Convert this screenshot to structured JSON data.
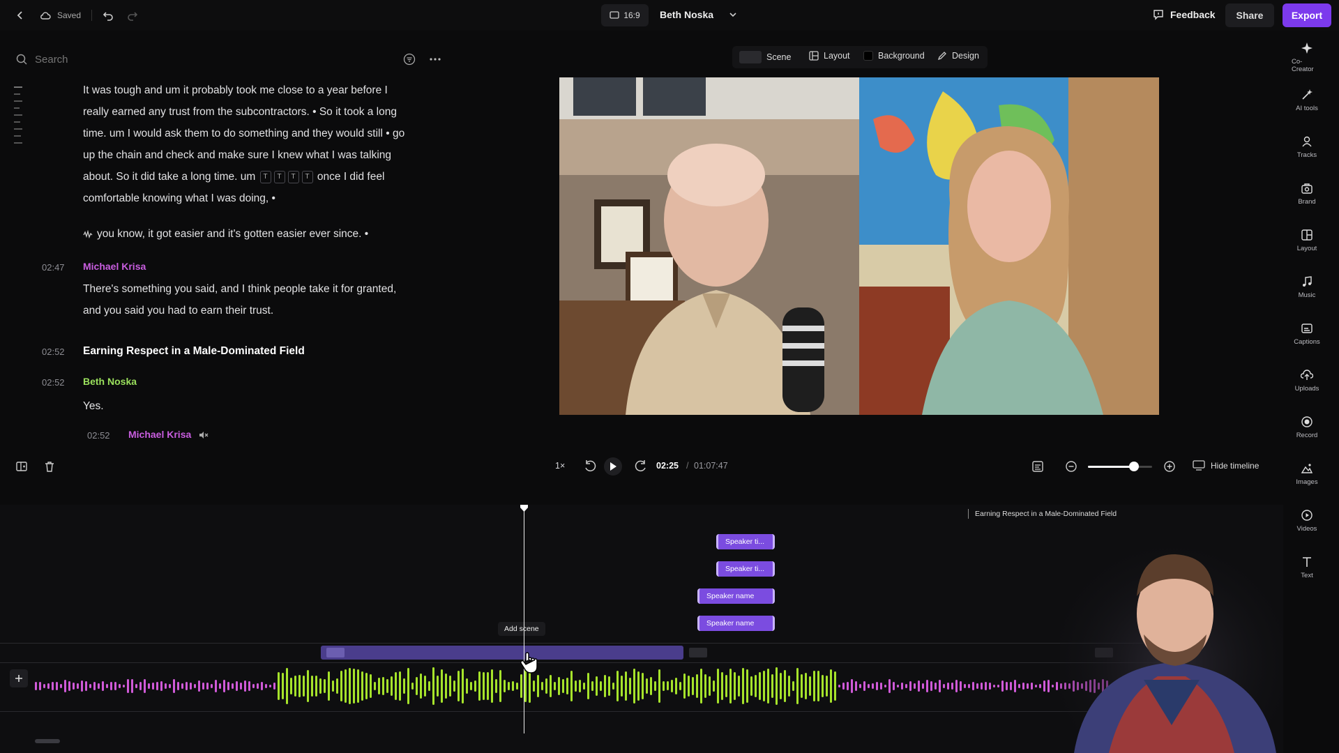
{
  "topbar": {
    "saved_label": "Saved",
    "aspect_ratio": "16:9",
    "project_title": "Beth Noska",
    "feedback_label": "Feedback",
    "share_label": "Share",
    "export_label": "Export"
  },
  "search": {
    "placeholder": "Search"
  },
  "transcript": {
    "para1": "It was tough and um it probably took me close to a year before I really earned any trust from the subcontractors. • So it took a long time. um I would ask them to do something and they would still • go up the chain and check and make sure I knew what I was talking about. So it did take a long time. um",
    "para1_tags": [
      "T",
      "T",
      "T",
      "T"
    ],
    "para1_end": "once I did feel comfortable knowing what I was doing, •",
    "para2": "you know, it got easier and it's gotten easier ever since. •",
    "block2_time": "02:47",
    "block2_speaker": "Michael Krisa",
    "block2_text": "There's something you said, and I think people take it for granted, and you said you had to earn their trust.",
    "chapter_time": "02:52",
    "chapter_title": "Earning Respect in a Male-Dominated Field",
    "block3_time": "02:52",
    "block3_speaker": "Beth Noska",
    "block3_text": "Yes.",
    "block4_time": "02:52",
    "block4_speaker": "Michael Krisa"
  },
  "preview_toolbar": {
    "scene_label": "Scene",
    "layout_label": "Layout",
    "background_label": "Background",
    "design_label": "Design"
  },
  "rail": [
    {
      "label": "Co-Creator",
      "icon": "sparkle-icon"
    },
    {
      "label": "AI tools",
      "icon": "wand-icon"
    },
    {
      "label": "Tracks",
      "icon": "people-icon"
    },
    {
      "label": "Brand",
      "icon": "brand-icon"
    },
    {
      "label": "Layout",
      "icon": "layout-icon"
    },
    {
      "label": "Music",
      "icon": "music-icon"
    },
    {
      "label": "Captions",
      "icon": "captions-icon"
    },
    {
      "label": "Uploads",
      "icon": "upload-icon"
    },
    {
      "label": "Record",
      "icon": "record-icon"
    },
    {
      "label": "Images",
      "icon": "images-icon"
    },
    {
      "label": "Videos",
      "icon": "videos-icon"
    },
    {
      "label": "Text",
      "icon": "text-icon"
    }
  ],
  "playback": {
    "speed": "1×",
    "current_time": "02:25",
    "separator": "/",
    "total_time": "01:07:47",
    "zoom_level": 0.72,
    "hide_timeline_label": "Hide timeline"
  },
  "timeline": {
    "chapter_label": "Earning Respect in a Male-Dominated Field",
    "chips": [
      "Speaker ti...",
      "Speaker ti...",
      "Speaker name",
      "Speaker name"
    ],
    "add_scene_tooltip": "Add scene"
  },
  "colors": {
    "accent": "#7b4ce0",
    "export_bg": "#7c3aed",
    "speaker_michael": "#c95ee0",
    "speaker_beth": "#9be15d",
    "waveform_green": "#a6e32b",
    "waveform_pink": "#d05ad8"
  }
}
